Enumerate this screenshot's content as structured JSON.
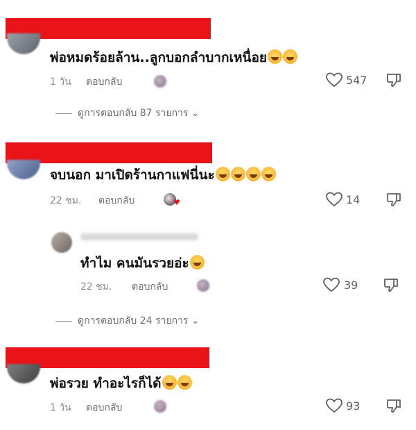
{
  "comments": [
    {
      "text": "พ่อหมดร้อยล้าน..ลูกบอกลำบากเหนื่อย",
      "time": "1 วัน",
      "reply": "ตอบกลับ",
      "likes": "547",
      "emoji": [
        "grinning-face",
        "tears-of-joy"
      ],
      "view_replies": "ดูการตอบกลับ 87 รายการ"
    },
    {
      "text": "จบนอก มาเปิดร้านกาแฟนี่นะ",
      "time": "22 ชม.",
      "reply": "ตอบกลับ",
      "likes": "14",
      "emoji": [
        "tears-of-joy",
        "tears-of-joy",
        "tears-of-joy",
        "tears-of-joy"
      ],
      "view_replies": "ดูการตอบกลับ 24 รายการ"
    },
    {
      "text": "ทำไม คนมันรวยอ่ะ",
      "time": "22 ชม.",
      "reply": "ตอบกลับ",
      "likes": "39",
      "emoji": [
        "face-with-hand-over-mouth"
      ]
    },
    {
      "text": "พ่อรวย ทำอะไรก็ได้",
      "time": "1 วัน",
      "reply": "ตอบกลับ",
      "likes": "93",
      "emoji": [
        "tears-of-joy",
        "rolling-on-floor-laughing"
      ]
    }
  ],
  "colors": {
    "redact": "#e8141a",
    "meta": "#8a8b91"
  }
}
